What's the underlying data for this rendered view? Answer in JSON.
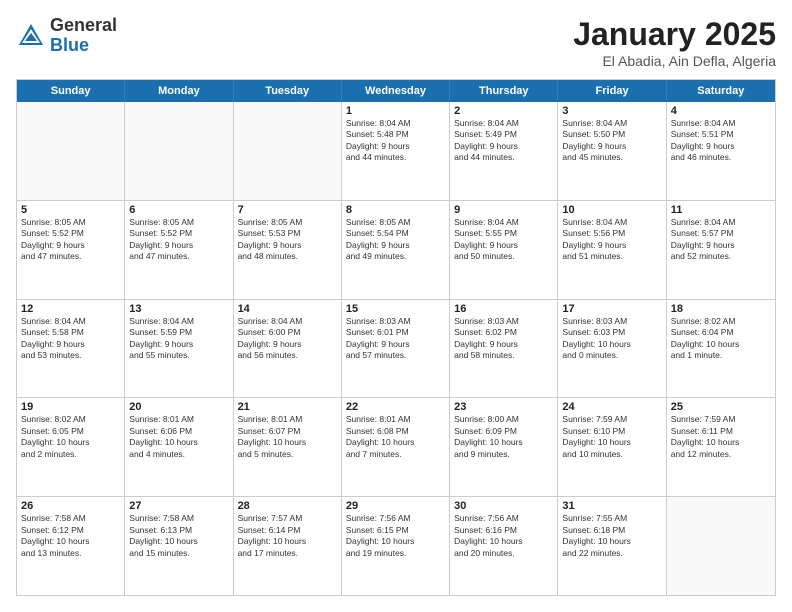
{
  "logo": {
    "general": "General",
    "blue": "Blue"
  },
  "title": {
    "month": "January 2025",
    "location": "El Abadia, Ain Defla, Algeria"
  },
  "header_days": [
    "Sunday",
    "Monday",
    "Tuesday",
    "Wednesday",
    "Thursday",
    "Friday",
    "Saturday"
  ],
  "rows": [
    [
      {
        "num": "",
        "lines": []
      },
      {
        "num": "",
        "lines": []
      },
      {
        "num": "",
        "lines": []
      },
      {
        "num": "1",
        "lines": [
          "Sunrise: 8:04 AM",
          "Sunset: 5:48 PM",
          "Daylight: 9 hours",
          "and 44 minutes."
        ]
      },
      {
        "num": "2",
        "lines": [
          "Sunrise: 8:04 AM",
          "Sunset: 5:49 PM",
          "Daylight: 9 hours",
          "and 44 minutes."
        ]
      },
      {
        "num": "3",
        "lines": [
          "Sunrise: 8:04 AM",
          "Sunset: 5:50 PM",
          "Daylight: 9 hours",
          "and 45 minutes."
        ]
      },
      {
        "num": "4",
        "lines": [
          "Sunrise: 8:04 AM",
          "Sunset: 5:51 PM",
          "Daylight: 9 hours",
          "and 46 minutes."
        ]
      }
    ],
    [
      {
        "num": "5",
        "lines": [
          "Sunrise: 8:05 AM",
          "Sunset: 5:52 PM",
          "Daylight: 9 hours",
          "and 47 minutes."
        ]
      },
      {
        "num": "6",
        "lines": [
          "Sunrise: 8:05 AM",
          "Sunset: 5:52 PM",
          "Daylight: 9 hours",
          "and 47 minutes."
        ]
      },
      {
        "num": "7",
        "lines": [
          "Sunrise: 8:05 AM",
          "Sunset: 5:53 PM",
          "Daylight: 9 hours",
          "and 48 minutes."
        ]
      },
      {
        "num": "8",
        "lines": [
          "Sunrise: 8:05 AM",
          "Sunset: 5:54 PM",
          "Daylight: 9 hours",
          "and 49 minutes."
        ]
      },
      {
        "num": "9",
        "lines": [
          "Sunrise: 8:04 AM",
          "Sunset: 5:55 PM",
          "Daylight: 9 hours",
          "and 50 minutes."
        ]
      },
      {
        "num": "10",
        "lines": [
          "Sunrise: 8:04 AM",
          "Sunset: 5:56 PM",
          "Daylight: 9 hours",
          "and 51 minutes."
        ]
      },
      {
        "num": "11",
        "lines": [
          "Sunrise: 8:04 AM",
          "Sunset: 5:57 PM",
          "Daylight: 9 hours",
          "and 52 minutes."
        ]
      }
    ],
    [
      {
        "num": "12",
        "lines": [
          "Sunrise: 8:04 AM",
          "Sunset: 5:58 PM",
          "Daylight: 9 hours",
          "and 53 minutes."
        ]
      },
      {
        "num": "13",
        "lines": [
          "Sunrise: 8:04 AM",
          "Sunset: 5:59 PM",
          "Daylight: 9 hours",
          "and 55 minutes."
        ]
      },
      {
        "num": "14",
        "lines": [
          "Sunrise: 8:04 AM",
          "Sunset: 6:00 PM",
          "Daylight: 9 hours",
          "and 56 minutes."
        ]
      },
      {
        "num": "15",
        "lines": [
          "Sunrise: 8:03 AM",
          "Sunset: 6:01 PM",
          "Daylight: 9 hours",
          "and 57 minutes."
        ]
      },
      {
        "num": "16",
        "lines": [
          "Sunrise: 8:03 AM",
          "Sunset: 6:02 PM",
          "Daylight: 9 hours",
          "and 58 minutes."
        ]
      },
      {
        "num": "17",
        "lines": [
          "Sunrise: 8:03 AM",
          "Sunset: 6:03 PM",
          "Daylight: 10 hours",
          "and 0 minutes."
        ]
      },
      {
        "num": "18",
        "lines": [
          "Sunrise: 8:02 AM",
          "Sunset: 6:04 PM",
          "Daylight: 10 hours",
          "and 1 minute."
        ]
      }
    ],
    [
      {
        "num": "19",
        "lines": [
          "Sunrise: 8:02 AM",
          "Sunset: 6:05 PM",
          "Daylight: 10 hours",
          "and 2 minutes."
        ]
      },
      {
        "num": "20",
        "lines": [
          "Sunrise: 8:01 AM",
          "Sunset: 6:06 PM",
          "Daylight: 10 hours",
          "and 4 minutes."
        ]
      },
      {
        "num": "21",
        "lines": [
          "Sunrise: 8:01 AM",
          "Sunset: 6:07 PM",
          "Daylight: 10 hours",
          "and 5 minutes."
        ]
      },
      {
        "num": "22",
        "lines": [
          "Sunrise: 8:01 AM",
          "Sunset: 6:08 PM",
          "Daylight: 10 hours",
          "and 7 minutes."
        ]
      },
      {
        "num": "23",
        "lines": [
          "Sunrise: 8:00 AM",
          "Sunset: 6:09 PM",
          "Daylight: 10 hours",
          "and 9 minutes."
        ]
      },
      {
        "num": "24",
        "lines": [
          "Sunrise: 7:59 AM",
          "Sunset: 6:10 PM",
          "Daylight: 10 hours",
          "and 10 minutes."
        ]
      },
      {
        "num": "25",
        "lines": [
          "Sunrise: 7:59 AM",
          "Sunset: 6:11 PM",
          "Daylight: 10 hours",
          "and 12 minutes."
        ]
      }
    ],
    [
      {
        "num": "26",
        "lines": [
          "Sunrise: 7:58 AM",
          "Sunset: 6:12 PM",
          "Daylight: 10 hours",
          "and 13 minutes."
        ]
      },
      {
        "num": "27",
        "lines": [
          "Sunrise: 7:58 AM",
          "Sunset: 6:13 PM",
          "Daylight: 10 hours",
          "and 15 minutes."
        ]
      },
      {
        "num": "28",
        "lines": [
          "Sunrise: 7:57 AM",
          "Sunset: 6:14 PM",
          "Daylight: 10 hours",
          "and 17 minutes."
        ]
      },
      {
        "num": "29",
        "lines": [
          "Sunrise: 7:56 AM",
          "Sunset: 6:15 PM",
          "Daylight: 10 hours",
          "and 19 minutes."
        ]
      },
      {
        "num": "30",
        "lines": [
          "Sunrise: 7:56 AM",
          "Sunset: 6:16 PM",
          "Daylight: 10 hours",
          "and 20 minutes."
        ]
      },
      {
        "num": "31",
        "lines": [
          "Sunrise: 7:55 AM",
          "Sunset: 6:18 PM",
          "Daylight: 10 hours",
          "and 22 minutes."
        ]
      },
      {
        "num": "",
        "lines": []
      }
    ]
  ]
}
